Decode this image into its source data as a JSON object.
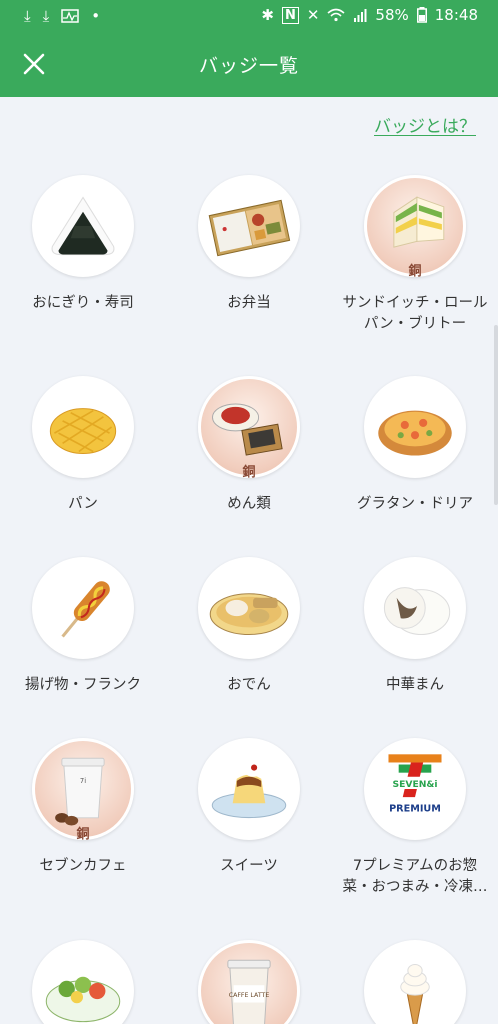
{
  "status_bar": {
    "battery": "58%",
    "time": "18:48"
  },
  "header": {
    "title": "バッジ一覧",
    "close_icon": "close-icon"
  },
  "help_link": "バッジとは？",
  "colors": {
    "primary": "#3aaa5c",
    "background": "#f0f3f8",
    "bronze": "#e6b8a4"
  },
  "badges": [
    {
      "label": "おにぎり・寿司",
      "icon": "onigiri-icon",
      "rank": ""
    },
    {
      "label": "お弁当",
      "icon": "bento-icon",
      "rank": ""
    },
    {
      "label": "サンドイッチ・ロールパン・ブリトー",
      "icon": "sandwich-icon",
      "rank": "銅"
    },
    {
      "label": "パン",
      "icon": "melon-pan-icon",
      "rank": ""
    },
    {
      "label": "めん類",
      "icon": "noodles-icon",
      "rank": "銅"
    },
    {
      "label": "グラタン・ドリア",
      "icon": "gratin-icon",
      "rank": ""
    },
    {
      "label": "揚げ物・フランク",
      "icon": "corndog-icon",
      "rank": ""
    },
    {
      "label": "おでん",
      "icon": "oden-icon",
      "rank": ""
    },
    {
      "label": "中華まん",
      "icon": "nikuman-icon",
      "rank": ""
    },
    {
      "label": "セブンカフェ",
      "icon": "coffee-cup-icon",
      "rank": "銅"
    },
    {
      "label": "スイーツ",
      "icon": "pudding-icon",
      "rank": ""
    },
    {
      "label": "7プレミアムのお惣菜・おつまみ・冷凍…",
      "icon": "seven-premium-logo",
      "rank": ""
    },
    {
      "label": "",
      "icon": "salad-icon",
      "rank": ""
    },
    {
      "label": "",
      "icon": "cafe-latte-icon",
      "rank": "銅"
    },
    {
      "label": "",
      "icon": "soft-cream-icon",
      "rank": ""
    }
  ],
  "seven_premium": {
    "brand": "SEVEN&i",
    "text": "PREMIUM"
  },
  "cafe_latte": {
    "cup_text": "CAFFE LATTE"
  }
}
